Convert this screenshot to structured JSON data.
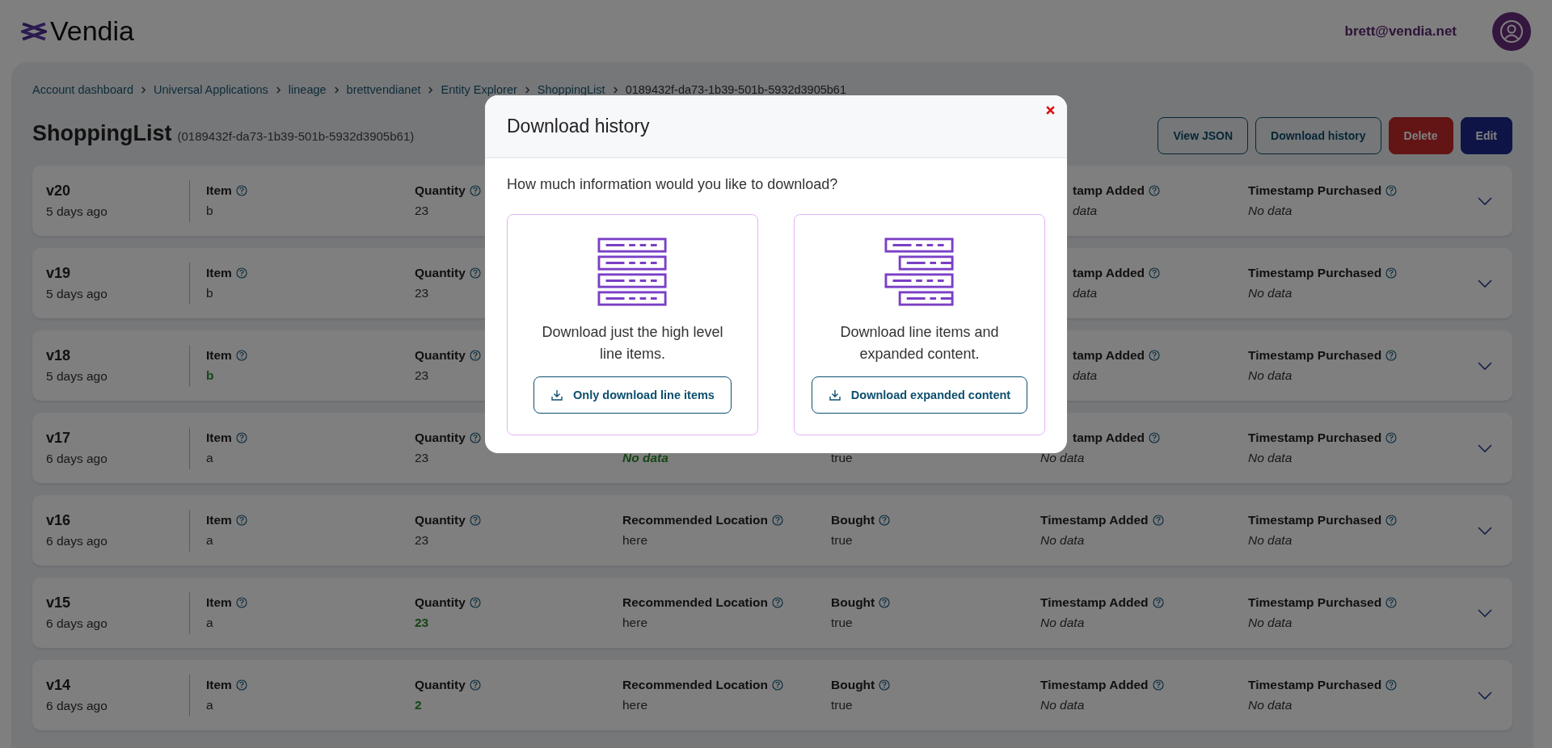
{
  "header": {
    "logo": "Vendia",
    "user_email": "brett@vendia.net"
  },
  "breadcrumb": [
    "Account dashboard",
    "Universal Applications",
    "lineage",
    "brettvendianet",
    "Entity Explorer",
    "ShoppingList",
    "0189432f-da73-1b39-501b-5932d3905b61"
  ],
  "page": {
    "title": "ShoppingList",
    "id": "(0189432f-da73-1b39-501b-5932d3905b61)"
  },
  "actions": [
    {
      "label": "View JSON",
      "kind": "outline"
    },
    {
      "label": "Download history",
      "kind": "outline"
    },
    {
      "label": "Delete",
      "kind": "danger"
    },
    {
      "label": "Edit",
      "kind": "primary"
    }
  ],
  "versions": [
    {
      "version": "v20",
      "age": "5 days ago",
      "fields": [
        {
          "kind": "item",
          "label": "Item",
          "value": "b",
          "changed": false,
          "missing": false
        },
        {
          "kind": "quantity",
          "label": "Quantity",
          "value": "23",
          "changed": false,
          "missing": false
        },
        {
          "kind": "added",
          "label": "tamp Added",
          "cut": true,
          "value": "data",
          "value_cut": true,
          "changed": false,
          "missing": true
        },
        {
          "kind": "purchased",
          "label": "Timestamp Purchased",
          "value": "No data",
          "changed": false,
          "missing": true
        }
      ]
    },
    {
      "version": "v19",
      "age": "5 days ago",
      "fields": [
        {
          "kind": "item",
          "label": "Item",
          "value": "b",
          "changed": false,
          "missing": false
        },
        {
          "kind": "quantity",
          "label": "Quantity",
          "value": "23",
          "changed": false,
          "missing": false
        },
        {
          "kind": "added",
          "label": "tamp Added",
          "cut": true,
          "value": "data",
          "value_cut": true,
          "changed": false,
          "missing": true
        },
        {
          "kind": "purchased",
          "label": "Timestamp Purchased",
          "value": "No data",
          "changed": false,
          "missing": true
        }
      ]
    },
    {
      "version": "v18",
      "age": "5 days ago",
      "fields": [
        {
          "kind": "item",
          "label": "Item",
          "value": "b",
          "changed": true,
          "missing": false
        },
        {
          "kind": "quantity",
          "label": "Quantity",
          "value": "23",
          "changed": false,
          "missing": false
        },
        {
          "kind": "added",
          "label": "tamp Added",
          "cut": true,
          "value": "data",
          "value_cut": true,
          "changed": false,
          "missing": true
        },
        {
          "kind": "purchased",
          "label": "Timestamp Purchased",
          "value": "No data",
          "changed": false,
          "missing": true
        }
      ]
    },
    {
      "version": "v17",
      "age": "6 days ago",
      "fields": [
        {
          "kind": "item",
          "label": "Item",
          "value": "a",
          "changed": false,
          "missing": false
        },
        {
          "kind": "quantity",
          "label": "Quantity",
          "value": "23",
          "changed": false,
          "missing": false
        },
        {
          "kind": "location",
          "value": "No data",
          "changed": true,
          "missing": true
        },
        {
          "kind": "bought",
          "value": "true",
          "changed": false,
          "missing": false
        },
        {
          "kind": "added",
          "label": "tamp Added",
          "cut": true,
          "value": "No data",
          "changed": false,
          "missing": true
        },
        {
          "kind": "purchased",
          "label": "Timestamp Purchased",
          "value": "No data",
          "changed": false,
          "missing": true
        }
      ]
    },
    {
      "version": "v16",
      "age": "6 days ago",
      "fields": [
        {
          "kind": "item",
          "label": "Item",
          "value": "a",
          "changed": false,
          "missing": false
        },
        {
          "kind": "quantity",
          "label": "Quantity",
          "value": "23",
          "changed": false,
          "missing": false
        },
        {
          "kind": "location",
          "label": "Recommended Location",
          "value": "here",
          "changed": false,
          "missing": false
        },
        {
          "kind": "bought",
          "label": "Bought",
          "value": "true",
          "changed": false,
          "missing": false
        },
        {
          "kind": "added",
          "label": "Timestamp Added",
          "value": "No data",
          "changed": false,
          "missing": true
        },
        {
          "kind": "purchased",
          "label": "Timestamp Purchased",
          "value": "No data",
          "changed": false,
          "missing": true
        }
      ]
    },
    {
      "version": "v15",
      "age": "6 days ago",
      "fields": [
        {
          "kind": "item",
          "label": "Item",
          "value": "a",
          "changed": false,
          "missing": false
        },
        {
          "kind": "quantity",
          "label": "Quantity",
          "value": "23",
          "changed": true,
          "missing": false
        },
        {
          "kind": "location",
          "label": "Recommended Location",
          "value": "here",
          "changed": false,
          "missing": false
        },
        {
          "kind": "bought",
          "label": "Bought",
          "value": "true",
          "changed": false,
          "missing": false
        },
        {
          "kind": "added",
          "label": "Timestamp Added",
          "value": "No data",
          "changed": false,
          "missing": true
        },
        {
          "kind": "purchased",
          "label": "Timestamp Purchased",
          "value": "No data",
          "changed": false,
          "missing": true
        }
      ]
    },
    {
      "version": "v14",
      "age": "6 days ago",
      "fields": [
        {
          "kind": "item",
          "label": "Item",
          "value": "a",
          "changed": false,
          "missing": false
        },
        {
          "kind": "quantity",
          "label": "Quantity",
          "value": "2",
          "changed": true,
          "missing": false
        },
        {
          "kind": "location",
          "label": "Recommended Location",
          "value": "here",
          "changed": false,
          "missing": false
        },
        {
          "kind": "bought",
          "label": "Bought",
          "value": "true",
          "changed": false,
          "missing": false
        },
        {
          "kind": "added",
          "label": "Timestamp Added",
          "value": "No data",
          "changed": false,
          "missing": true
        },
        {
          "kind": "purchased",
          "label": "Timestamp Purchased",
          "value": "No data",
          "changed": false,
          "missing": true
        }
      ]
    }
  ],
  "modal": {
    "title": "Download history",
    "question": "How much information would you like to download?",
    "options": [
      {
        "kind": "flat",
        "description": "Download just the high level line items.",
        "button": "Only download line items"
      },
      {
        "kind": "expanded",
        "description": "Download line items and expanded content.",
        "button": "Download expanded content"
      }
    ]
  }
}
